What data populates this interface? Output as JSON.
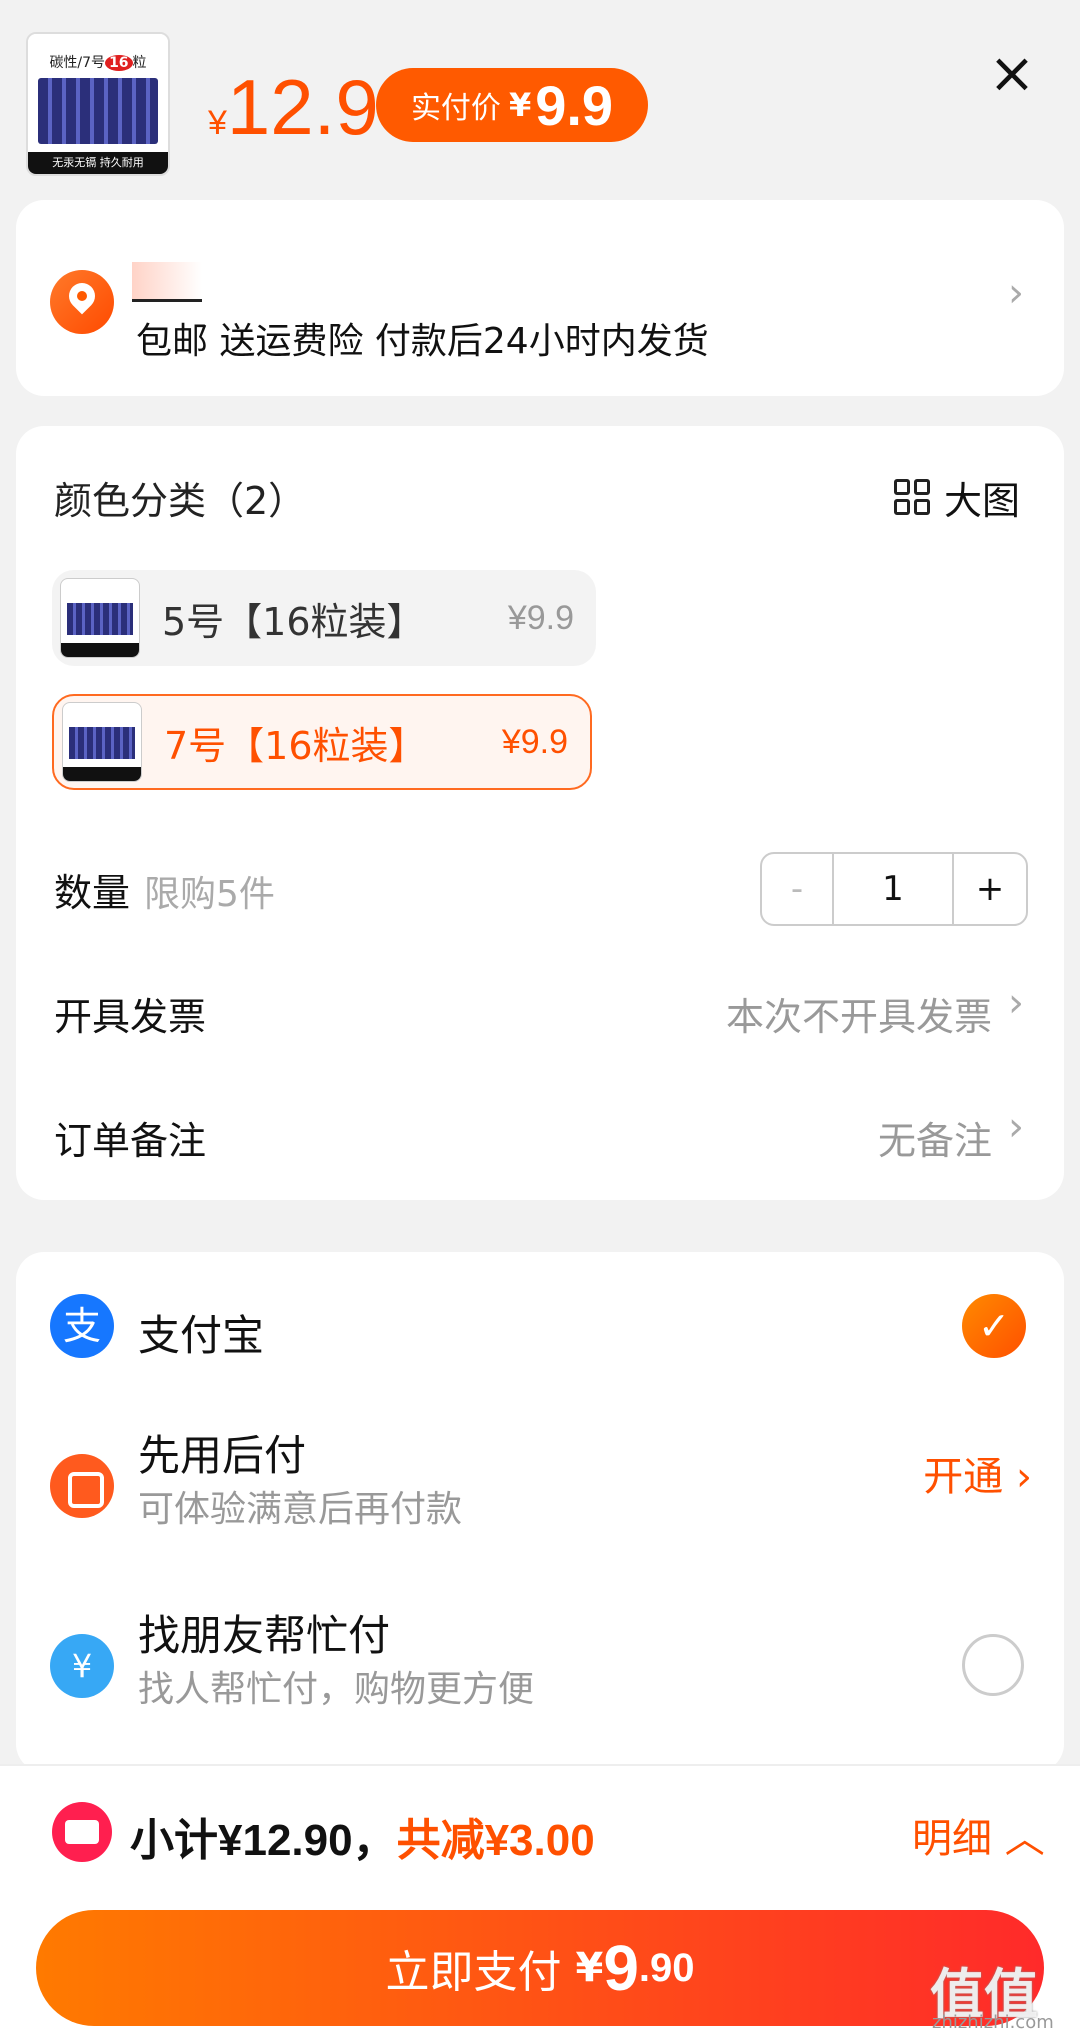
{
  "header": {
    "thumb": {
      "top": "",
      "label_prefix": "碳性/7号",
      "label_num": "16",
      "label_suffix": "粒",
      "foot": "无汞无镉 持久耐用"
    },
    "price_yen": "¥",
    "price": "12.9",
    "pay_label": "实付价",
    "pay_yen": "¥",
    "pay_value": "9.9"
  },
  "address": {
    "text": "包邮 送运费险 付款后24小时内发货"
  },
  "spec": {
    "title": "颜色分类（2）",
    "big_image": "大图",
    "options": [
      {
        "label": "5号【16粒装】",
        "price": "¥9.9",
        "selected": false
      },
      {
        "label": "7号【16粒装】",
        "price": "¥9.9",
        "selected": true
      }
    ],
    "quantity_label": "数量",
    "quantity_limit": "限购5件",
    "quantity": "1",
    "minus": "-",
    "plus": "+",
    "invoice_label": "开具发票",
    "invoice_value": "本次不开具发票",
    "note_label": "订单备注",
    "note_value": "无备注"
  },
  "payment": {
    "methods": [
      {
        "name": "支付宝",
        "desc": "",
        "state": "checked"
      },
      {
        "name": "先用后付",
        "desc": "可体验满意后再付款",
        "action": "开通"
      },
      {
        "name": "找朋友帮忙付",
        "desc": "找人帮忙付，购物更方便",
        "state": "unchecked"
      }
    ]
  },
  "bottom": {
    "subtotal": "小计¥12.90，",
    "discount": "共减¥3.00",
    "detail": "明细",
    "pay_label": "立即支付",
    "pay_yen": "¥",
    "pay_int": "9",
    "pay_dec": ".90"
  },
  "watermark": {
    "main": "值值值",
    "sub": "zhizhizhi.com"
  },
  "colors": {
    "accent": "#ff5000",
    "alipay": "#1677ff",
    "background": "#f2f2f2"
  }
}
